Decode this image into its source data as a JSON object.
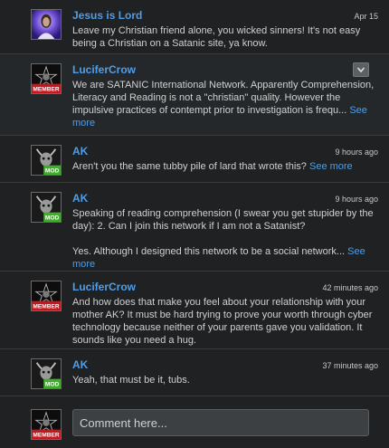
{
  "comments": [
    {
      "author": "Jesus is Lord",
      "time": "Apr 15",
      "text": "Leave my Christian friend alone, you wicked sinners! It's not easy being a Christian on a Satanic site, ya know."
    },
    {
      "author": "LuciferCrow",
      "badge": "MEMBER",
      "text": "We are SATANIC International Network. Apparently Comprehension, Literacy and Reading is not a \"christian\" quality. However the impulsive practices of contempt prior to investigation is frequ...",
      "see_more": "See more"
    },
    {
      "author": "AK",
      "badge": "MOD",
      "time": "9 hours ago",
      "text": "Aren't you the same tubby pile of lard that wrote this?",
      "see_more": "See more"
    },
    {
      "author": "AK",
      "badge": "MOD",
      "time": "9 hours ago",
      "text": "Speaking of reading comprehension (I swear you get stupider by the day): 2. Can I join this network if I am not a Satanist?",
      "text2": "Yes. Although I designed this network to be a social network...",
      "see_more": "See more"
    },
    {
      "author": "LuciferCrow",
      "badge": "MEMBER",
      "time": "42 minutes ago",
      "text": "And how does that make you feel about your relationship with your mother AK? It must be hard trying to prove your worth through cyber technology because neither of your parents gave you validation. It sounds like you need a hug."
    },
    {
      "author": "AK",
      "badge": "MOD",
      "time": "37 minutes ago",
      "text": "Yeah, that must be it, tubs."
    }
  ],
  "composer": {
    "badge": "MEMBER",
    "placeholder": "Comment here..."
  },
  "colors": {
    "link": "#4f9ee8",
    "member_badge": "#c8161d",
    "mod_badge": "#3fae2a"
  }
}
